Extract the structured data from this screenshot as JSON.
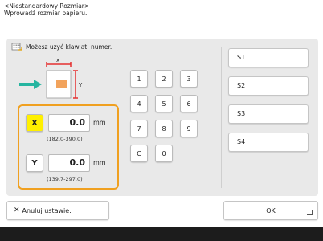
{
  "header": {
    "title": "<Niestandardowy Rozmiar>",
    "subtitle": "Wprowadź rozmiar papieru."
  },
  "hint": {
    "text": "Możesz użyć klawiat. numer.",
    "icon": "keyboard-icon"
  },
  "diagram": {
    "x_label": "x",
    "y_label": "Y"
  },
  "dimensions": {
    "x": {
      "button_label": "X",
      "value": "0.0",
      "unit": "mm",
      "range": "(182.0-390.0)",
      "active": true
    },
    "y": {
      "button_label": "Y",
      "value": "0.0",
      "unit": "mm",
      "range": "(139.7-297.0)",
      "active": false
    }
  },
  "keypad": {
    "keys": [
      "1",
      "2",
      "3",
      "4",
      "5",
      "6",
      "7",
      "8",
      "9",
      "C",
      "0"
    ]
  },
  "saved_sizes": [
    {
      "label": "S1"
    },
    {
      "label": "S2"
    },
    {
      "label": "S3"
    },
    {
      "label": "S4"
    }
  ],
  "footer": {
    "cancel_label": "Anuluj ustawie.",
    "ok_label": "OK"
  },
  "colors": {
    "highlight": "#fff000",
    "group_border": "#f0a020",
    "arrow_green": "#26b5a0",
    "arrow_red": "#e53030"
  }
}
